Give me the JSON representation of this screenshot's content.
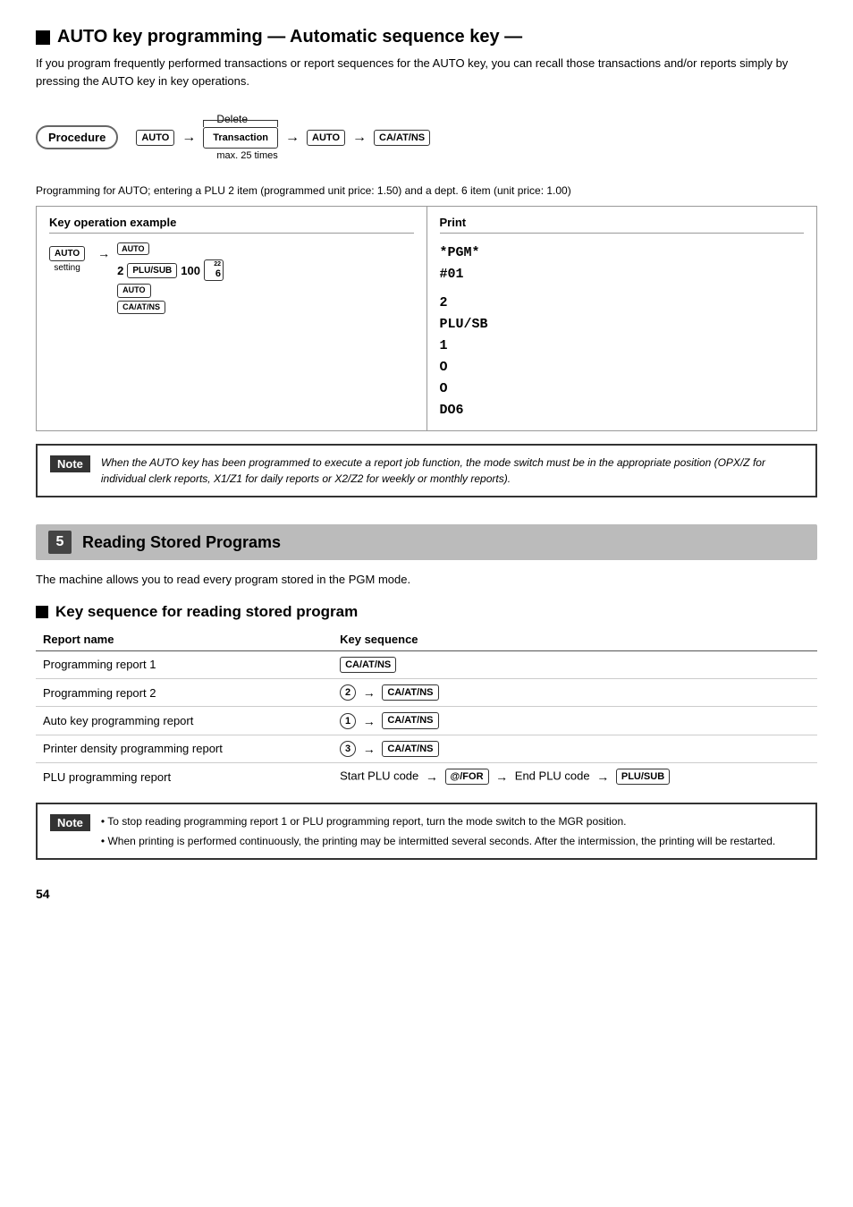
{
  "page": {
    "number": "54"
  },
  "auto_key_section": {
    "heading": "AUTO key programming — Automatic sequence key —",
    "intro": "If you program frequently performed transactions or report sequences for the AUTO key, you can recall those transactions and/or reports simply by pressing the AUTO key in key operations.",
    "procedure_label": "Procedure",
    "procedure_delete": "Delete",
    "procedure_max": "max. 25 times",
    "programming_note": "Programming for AUTO; entering a PLU 2 item (programmed unit price: 1.50) and a dept. 6 item (unit price: 1.00)",
    "example_col_header": "Key operation example",
    "print_col_header": "Print",
    "print_content": "*PGM*\n#01\n\n2\nPLU/SB\n1\nO\nO\nDO6",
    "auto_setting_label": "AUTO\nsetting",
    "note_text": "When the AUTO key has been programmed to execute a report job function, the mode switch must be in the appropriate position (OPX/Z for individual clerk reports, X1/Z1 for daily reports or X2/Z2 for weekly or monthly reports)."
  },
  "section5": {
    "number": "5",
    "title": "Reading Stored Programs",
    "intro": "The machine allows you to read every program stored in the PGM mode.",
    "sub_heading": "Key sequence for reading stored program",
    "table": {
      "col1_header": "Report name",
      "col2_header": "Key sequence",
      "rows": [
        {
          "name": "Programming report 1",
          "key_seq": "CA/AT/NS"
        },
        {
          "name": "Programming report 2",
          "key_seq": "2 → CA/AT/NS"
        },
        {
          "name": "Auto key programming report",
          "key_seq": "1 → CA/AT/NS"
        },
        {
          "name": "Printer density programming report",
          "key_seq": "3 → CA/AT/NS"
        },
        {
          "name": "PLU programming report",
          "key_seq": "Start PLU code → @/FOR → End PLU code → PLU/SUB"
        }
      ]
    },
    "note_items": [
      "To stop reading programming report 1 or PLU programming report, turn the mode switch to the MGR position.",
      "When printing is performed continuously, the printing may be intermitted several seconds.  After the intermission, the printing will be restarted."
    ]
  }
}
